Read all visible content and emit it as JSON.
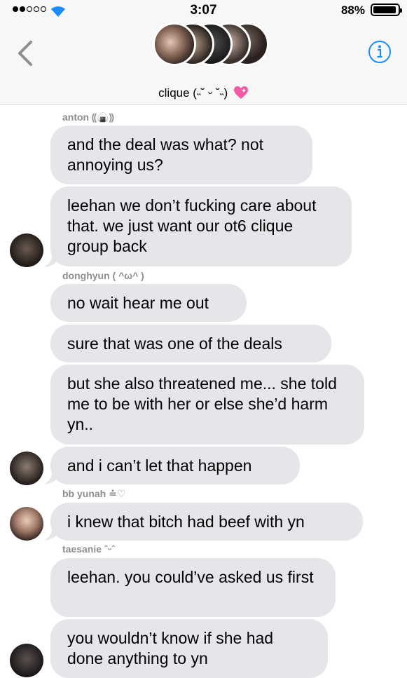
{
  "status": {
    "time": "3:07",
    "battery": "88%",
    "battery_level": 0.88,
    "signal_bars_filled": 2,
    "signal_bars_total": 5
  },
  "header": {
    "title": "clique (˵˘ ᵕ ˘˵)",
    "back_icon": "chevron-left-icon",
    "info_icon": "info-icon",
    "accent_color": "#1a8cff"
  },
  "messages": [
    {
      "sender": "anton ⸨🍙⸩",
      "text": "and the deal was what? not annoying us?"
    },
    {
      "sender": "",
      "text": "leehan we don’t fucking care about that. we just want our ot6 clique group back"
    },
    {
      "sender": "donghyun ( ^ω^ )",
      "text": "no wait hear me out"
    },
    {
      "sender": "",
      "text": "sure that was one of the deals"
    },
    {
      "sender": "",
      "text": "but she also threatened me... she told me to be with her or else she’d harm yn.."
    },
    {
      "sender": "",
      "text": "and i can’t let that happen"
    },
    {
      "sender": "bb yunah ≐♡",
      "text": "i knew that bitch had beef with yn"
    },
    {
      "sender": "taesanie ˆᵕˆ",
      "text": "leehan. you could’ve asked us first"
    },
    {
      "sender": "",
      "text": "you wouldn’t know if she had done anything to yn"
    }
  ],
  "colors": {
    "bubble": "#e5e5ea",
    "name": "#8e8e93",
    "header_bg": "#f7f7f7"
  }
}
